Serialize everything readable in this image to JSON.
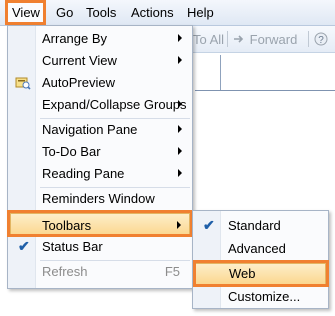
{
  "menubar": {
    "items": [
      {
        "label": "View",
        "underline": "V"
      },
      {
        "label": "Go",
        "underline": "G"
      },
      {
        "label": "Tools",
        "underline": "T"
      },
      {
        "label": "Actions",
        "underline": "A"
      },
      {
        "label": "Help",
        "underline": "H"
      }
    ]
  },
  "toolbar": {
    "to_all_label": "To All",
    "forward_label": "Forward"
  },
  "view_menu": {
    "items": [
      {
        "label": "Arrange By",
        "submenu": true
      },
      {
        "label": "Current View",
        "submenu": true
      },
      {
        "label": "AutoPreview",
        "icon": "autopreview-icon"
      },
      {
        "label": "Expand/Collapse Groups",
        "submenu": true
      },
      {
        "label": "Navigation Pane",
        "submenu": true
      },
      {
        "label": "To-Do Bar",
        "submenu": true
      },
      {
        "label": "Reading Pane",
        "submenu": true
      },
      {
        "label": "Reminders Window"
      },
      {
        "label": "Toolbars",
        "submenu": true,
        "highlighted": true
      },
      {
        "label": "Status Bar",
        "checked": true
      },
      {
        "label": "Refresh",
        "shortcut": "F5",
        "disabled": true
      }
    ]
  },
  "toolbars_submenu": {
    "items": [
      {
        "label": "Standard",
        "checked": true
      },
      {
        "label": "Advanced"
      },
      {
        "label": "Web",
        "highlighted": true
      },
      {
        "label": "Customize..."
      }
    ]
  },
  "colors": {
    "highlight_outline": "#f08030",
    "menu_hover": "#fbd78f",
    "check": "#1f5fa8"
  }
}
